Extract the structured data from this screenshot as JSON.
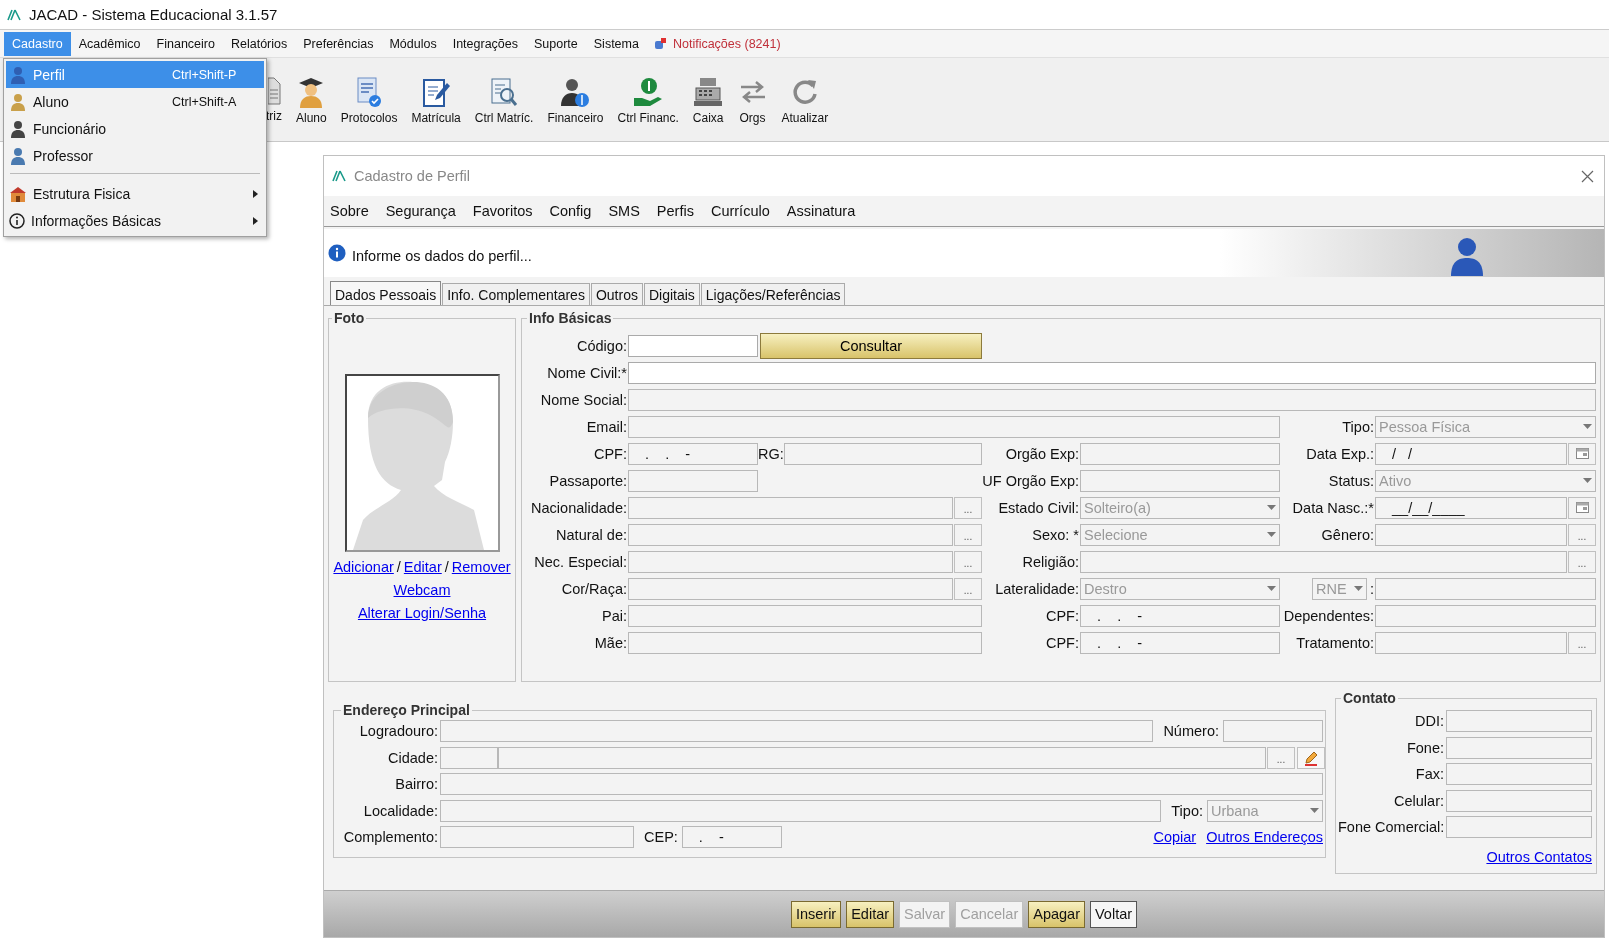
{
  "app_title": "JACAD - Sistema Educacional 3.1.57",
  "menubar": [
    {
      "label": "Cadastro",
      "kind": "menu",
      "selected": true
    },
    {
      "label": "Acadêmico",
      "kind": "menu",
      "selected": false
    },
    {
      "label": "Financeiro",
      "kind": "menu",
      "selected": false
    },
    {
      "label": "Relatórios",
      "kind": "menu",
      "selected": false
    },
    {
      "label": "Preferências",
      "kind": "menu",
      "selected": false
    },
    {
      "label": "Módulos",
      "kind": "menu",
      "selected": false
    },
    {
      "label": "Integrações",
      "kind": "menu",
      "selected": false
    },
    {
      "label": "Suporte",
      "kind": "menu",
      "selected": false
    },
    {
      "label": "Sistema",
      "kind": "menu",
      "selected": false
    },
    {
      "label": "Notificações (8241)",
      "kind": "notification",
      "selected": false
    }
  ],
  "dropdown": [
    {
      "kind": "item",
      "label": "Perfil",
      "shortcut": "Ctrl+Shift-P",
      "selected": true,
      "submenu": false
    },
    {
      "kind": "item",
      "label": "Aluno",
      "shortcut": "Ctrl+Shift-A",
      "selected": false,
      "submenu": false
    },
    {
      "kind": "item",
      "label": "Funcionário",
      "selected": false,
      "submenu": false
    },
    {
      "kind": "item",
      "label": "Professor",
      "selected": false,
      "submenu": false
    },
    {
      "kind": "separator"
    },
    {
      "kind": "item",
      "label": "Estrutura Fisica",
      "selected": false,
      "submenu": true
    },
    {
      "kind": "item",
      "label": "Informações Básicas",
      "selected": false,
      "submenu": true
    }
  ],
  "toolbar": [
    {
      "label": "triz"
    },
    {
      "label": "Aluno"
    },
    {
      "label": "Protocolos"
    },
    {
      "label": "Matrícula"
    },
    {
      "label": "Ctrl Matríc."
    },
    {
      "label": "Financeiro"
    },
    {
      "label": "Ctrl Financ."
    },
    {
      "label": "Caixa"
    },
    {
      "label": "Orgs"
    },
    {
      "label": "Atualizar"
    }
  ],
  "window": {
    "title": "Cadastro de Perfil",
    "menu": [
      "Sobre",
      "Segurança",
      "Favoritos",
      "Config",
      "SMS",
      "Perfis",
      "Currículo",
      "Assinatura"
    ],
    "info_message": "Informe os dados do perfil...",
    "tabs": [
      {
        "label": "Dados Pessoais",
        "selected": true
      },
      {
        "label": "Info. Complementares",
        "selected": false
      },
      {
        "label": "Outros",
        "selected": false
      },
      {
        "label": "Digitais",
        "selected": false
      },
      {
        "label": "Ligações/Referências",
        "selected": false
      }
    ]
  },
  "foto": {
    "title": "Foto",
    "link_lines": [
      [
        {
          "kind": "link",
          "text": "Adicionar"
        },
        {
          "kind": "separator",
          "text": "/"
        },
        {
          "kind": "link",
          "text": "Editar"
        },
        {
          "kind": "separator",
          "text": "/"
        },
        {
          "kind": "link",
          "text": "Remover"
        }
      ],
      [
        {
          "kind": "link",
          "text": "Webcam"
        }
      ],
      [
        {
          "kind": "link",
          "text": "Alterar Login/Senha"
        }
      ]
    ]
  },
  "info_basicas": {
    "title": "Info Básicas",
    "rows": [
      [
        {
          "label": "Código:",
          "kind": "text",
          "disabled": false
        },
        {
          "label": "Consultar",
          "kind": "button"
        }
      ],
      [
        {
          "label": "Nome Civil:*",
          "kind": "text",
          "disabled": false
        }
      ],
      [
        {
          "label": "Nome Social:",
          "kind": "text",
          "disabled": true
        }
      ],
      [
        {
          "label": "Email:",
          "kind": "text",
          "disabled": true
        },
        {
          "label": "Tipo:",
          "kind": "select",
          "value": "Pessoa Física",
          "disabled": true
        }
      ],
      [
        {
          "label": "CPF:",
          "kind": "text",
          "value": ".    .    -",
          "disabled": true
        },
        {
          "label": "RG:",
          "kind": "text",
          "disabled": true
        },
        {
          "label": "Orgão Exp:",
          "kind": "text",
          "disabled": true
        },
        {
          "label": "Data Exp.:",
          "kind": "date",
          "value": "/   /",
          "disabled": true
        }
      ],
      [
        {
          "label": "Passaporte:",
          "kind": "text",
          "disabled": true
        },
        {
          "label": "UF Orgão Exp:",
          "kind": "text",
          "disabled": true
        },
        {
          "label": "Status:",
          "kind": "select",
          "value": "Ativo",
          "disabled": true
        }
      ],
      [
        {
          "label": "Nacionalidade:",
          "kind": "lookup",
          "button": "...",
          "disabled": true
        },
        {
          "label": "Estado Civil:",
          "kind": "select",
          "value": "Solteiro(a)",
          "disabled": true
        },
        {
          "label": "Data Nasc.:*",
          "kind": "date",
          "value": "__/__/____",
          "disabled": true
        }
      ],
      [
        {
          "label": "Natural de:",
          "kind": "lookup",
          "button": "...",
          "disabled": true
        },
        {
          "label": "Sexo: *",
          "kind": "select",
          "value": "Selecione",
          "disabled": true
        },
        {
          "label": "Gênero:",
          "kind": "lookup",
          "button": "...",
          "disabled": true
        }
      ],
      [
        {
          "label": "Nec. Especial:",
          "kind": "lookup",
          "button": "...",
          "disabled": true
        },
        {
          "label": "Religião:",
          "kind": "lookup",
          "button": "...",
          "disabled": true
        }
      ],
      [
        {
          "label": "Cor/Raça:",
          "kind": "lookup",
          "button": "...",
          "disabled": true
        },
        {
          "label": "Lateralidade:",
          "kind": "select",
          "value": "Destro",
          "disabled": true
        },
        {
          "label": ":",
          "kind": "text",
          "disabled": true,
          "label_select": {
            "value": "RNE",
            "disabled": true
          }
        }
      ],
      [
        {
          "label": "Pai:",
          "kind": "text",
          "disabled": true
        },
        {
          "label": "CPF:",
          "kind": "text",
          "value": ".    .    -",
          "disabled": true
        },
        {
          "label": "Dependentes:",
          "kind": "text",
          "disabled": true
        }
      ],
      [
        {
          "label": "Mãe:",
          "kind": "text",
          "disabled": true
        },
        {
          "label": "CPF:",
          "kind": "text",
          "value": ".    .    -",
          "disabled": true
        },
        {
          "label": "Tratamento:",
          "kind": "lookup",
          "button": "...",
          "disabled": true
        }
      ]
    ]
  },
  "endereco": {
    "title": "Endereço Principal",
    "lines": [
      [
        {
          "label": "Logradouro:",
          "kind": "text",
          "disabled": true
        },
        {
          "label": "Número:",
          "kind": "text",
          "disabled": true
        }
      ],
      [
        {
          "label": "Cidade:",
          "kind": "text",
          "disabled": true
        },
        {
          "kind": "lookup",
          "button": "...",
          "disabled": true
        },
        {
          "kind": "edit"
        }
      ],
      [
        {
          "label": "Bairro:",
          "kind": "text",
          "disabled": true
        }
      ],
      [
        {
          "label": "Localidade:",
          "kind": "text",
          "disabled": true
        },
        {
          "label": "Tipo:",
          "kind": "select",
          "value": "Urbana",
          "disabled": true
        }
      ],
      [
        {
          "label": "Complemento:",
          "kind": "text",
          "disabled": true
        },
        {
          "label": "CEP:",
          "kind": "text",
          "value": ".    -",
          "disabled": true
        },
        {
          "label": "Copiar",
          "kind": "link"
        },
        {
          "label": "Outros Endereços",
          "kind": "link"
        }
      ]
    ]
  },
  "contato": {
    "title": "Contato",
    "fields": [
      {
        "label": "DDI:",
        "disabled": true
      },
      {
        "label": "Fone:",
        "disabled": true
      },
      {
        "label": "Fax:",
        "disabled": true
      },
      {
        "label": "Celular:",
        "disabled": true
      },
      {
        "label": "Fone Comercial:",
        "disabled": true
      }
    ],
    "link": "Outros Contatos"
  },
  "actions": [
    {
      "label": "Inserir",
      "disabled": false,
      "highlighted": true
    },
    {
      "label": "Editar",
      "disabled": false,
      "highlighted": true
    },
    {
      "label": "Salvar",
      "disabled": true,
      "highlighted": false
    },
    {
      "label": "Cancelar",
      "disabled": true,
      "highlighted": false
    },
    {
      "label": "Apagar",
      "disabled": false,
      "highlighted": true
    },
    {
      "label": "Voltar",
      "disabled": false,
      "highlighted": false
    }
  ]
}
